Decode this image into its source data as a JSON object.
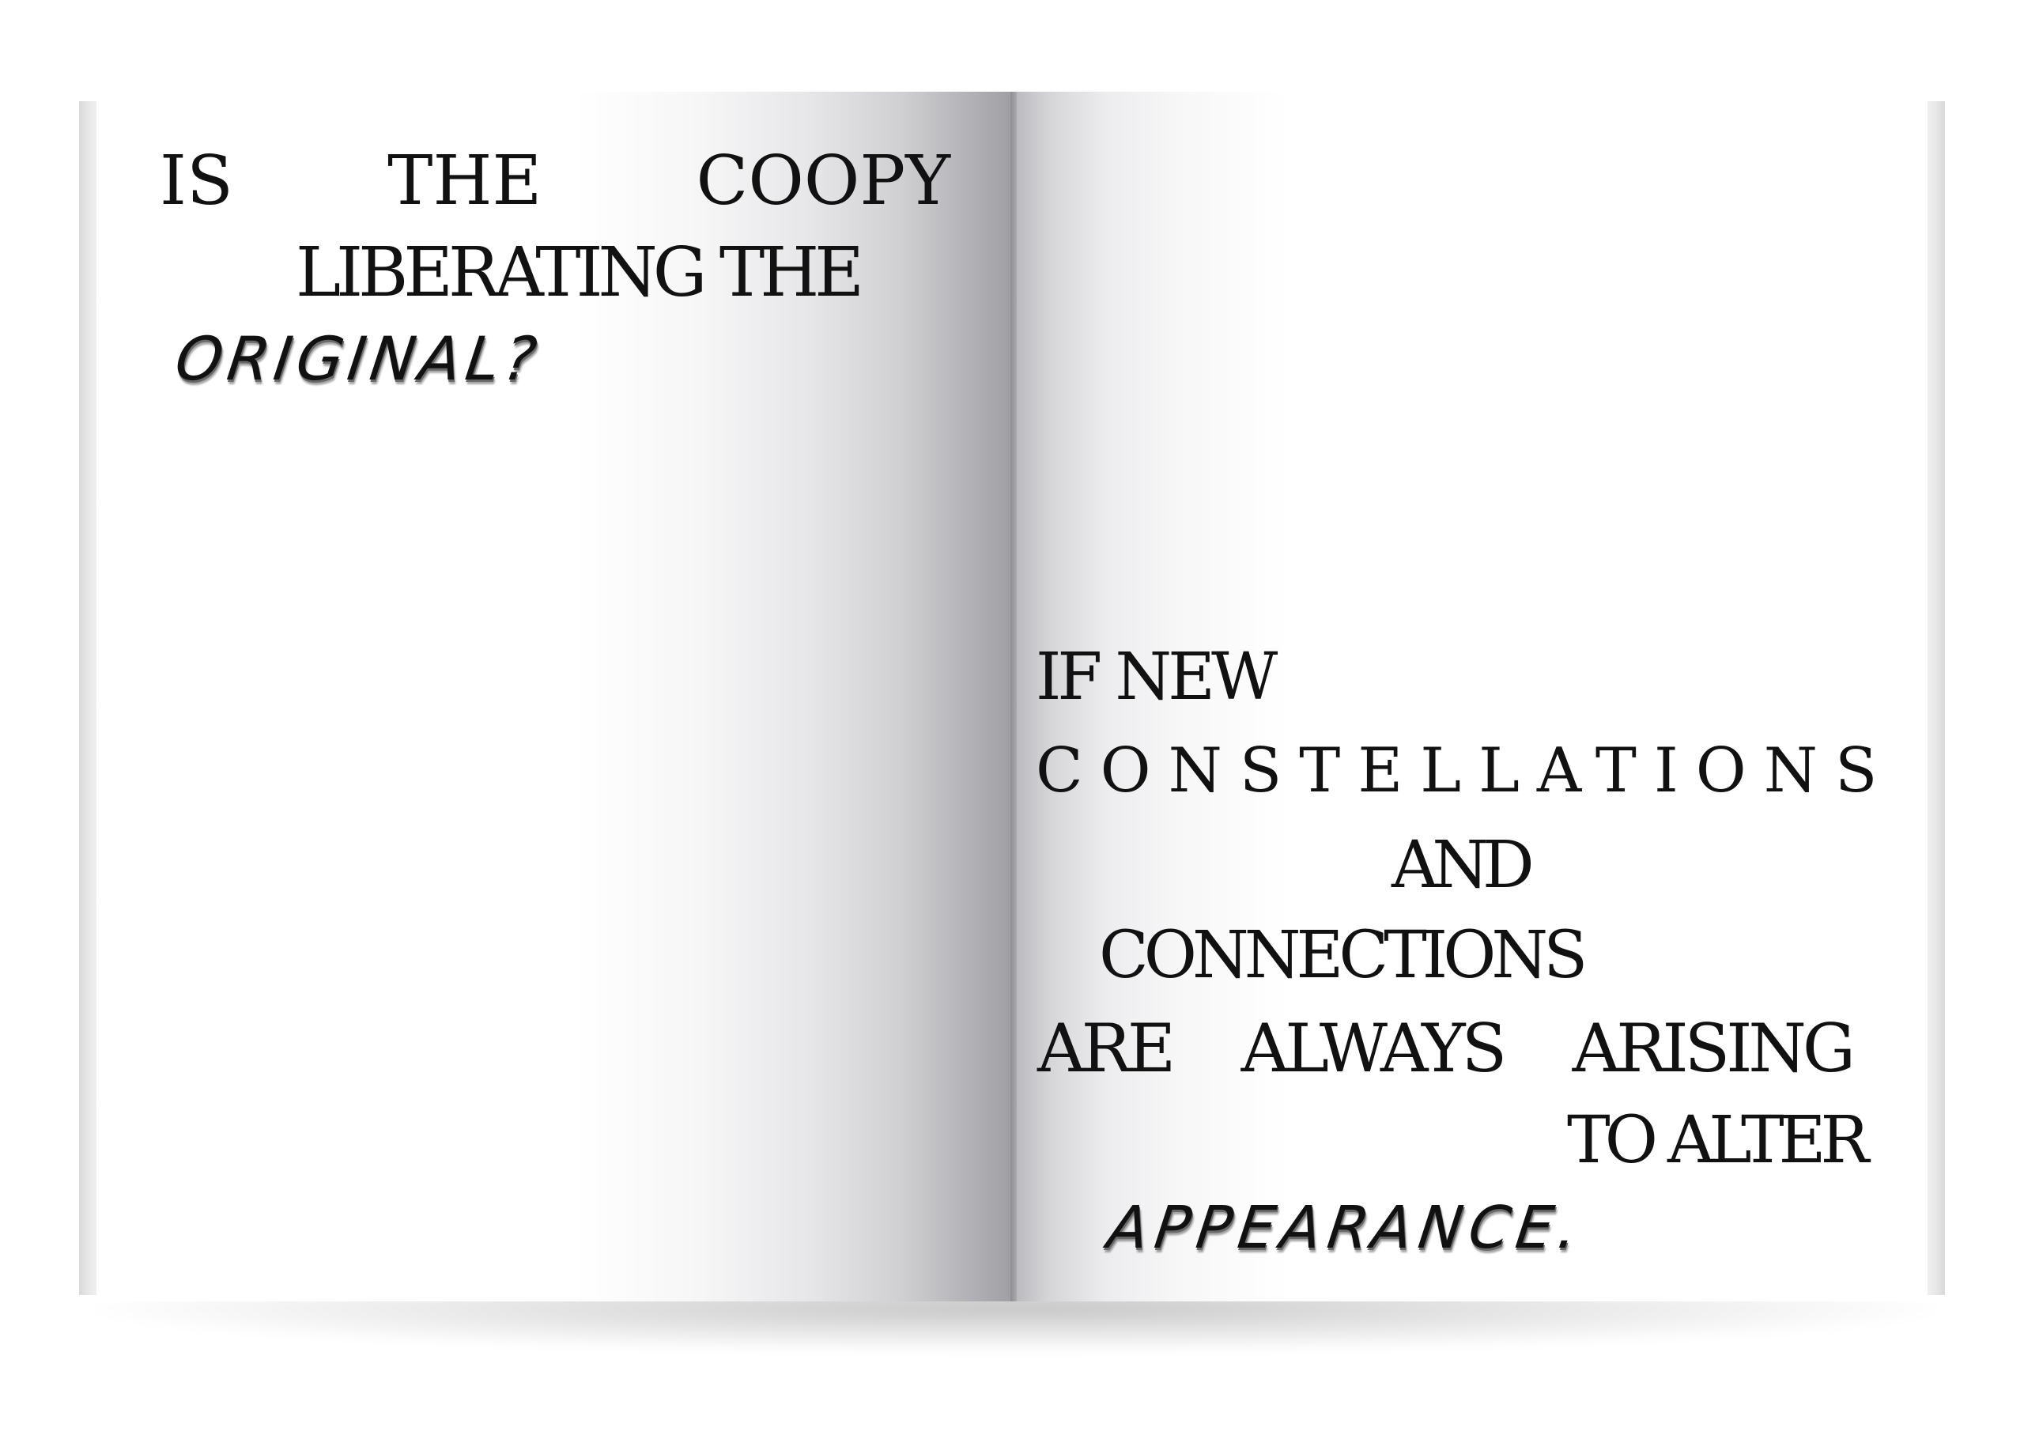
{
  "left_page": {
    "line1": {
      "word1": "IS",
      "word2": "THE",
      "word3": "COOPY"
    },
    "line2": "LIBERATING THE",
    "line3": "ORIGINAL?"
  },
  "right_page": {
    "line1": "IF NEW",
    "line2": "CONSTELLATIONS",
    "line3": "AND",
    "line4": "CONNECTIONS",
    "line5": {
      "word1": "ARE",
      "word2": "ALWAYS",
      "word3": "ARISING"
    },
    "line6": "TO ALTER",
    "line7": "APPEARANCE."
  }
}
